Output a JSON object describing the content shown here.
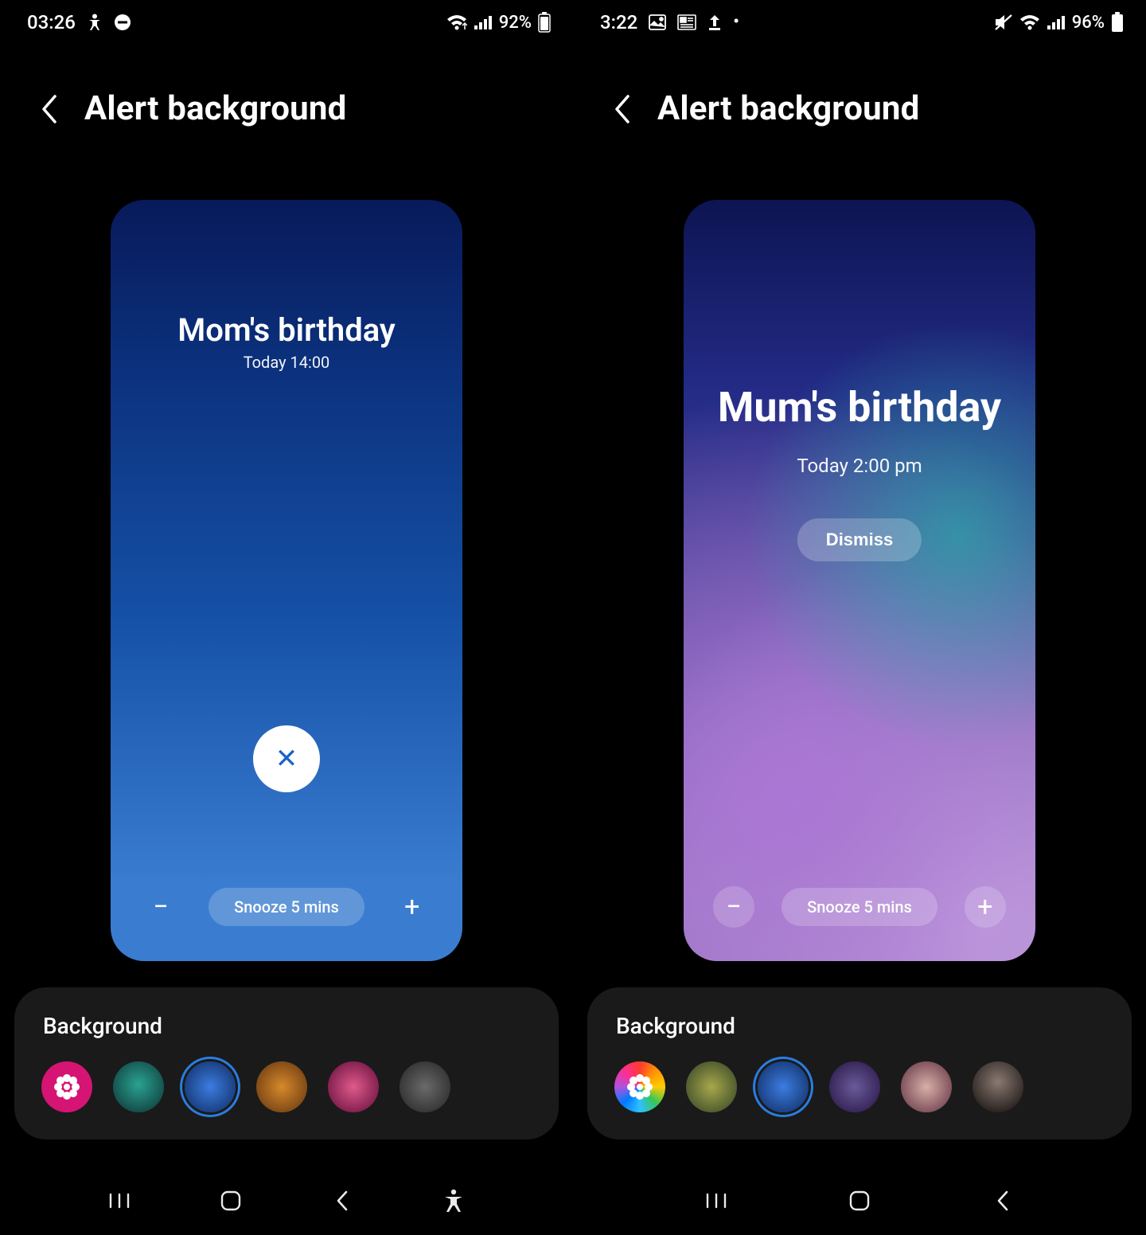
{
  "left": {
    "status": {
      "time": "03:26",
      "battery": "92%"
    },
    "title": "Alert background",
    "alert": {
      "name": "Mom's birthday",
      "subtitle": "Today 14:00",
      "snooze": "Snooze 5 mins"
    },
    "panel": {
      "title": "Background"
    }
  },
  "right": {
    "status": {
      "time": "3:22",
      "battery": "96%"
    },
    "title": "Alert background",
    "alert": {
      "name": "Mum's birthday",
      "subtitle": "Today 2:00 pm",
      "dismiss": "Dismiss",
      "snooze": "Snooze 5 mins"
    },
    "panel": {
      "title": "Background"
    }
  },
  "swatches_left": [
    "gallery-magenta",
    "teal",
    "blue",
    "orange",
    "pink",
    "grey"
  ],
  "swatches_right": [
    "gallery-rainbow",
    "olive",
    "blue",
    "violet",
    "peach",
    "taupe"
  ]
}
